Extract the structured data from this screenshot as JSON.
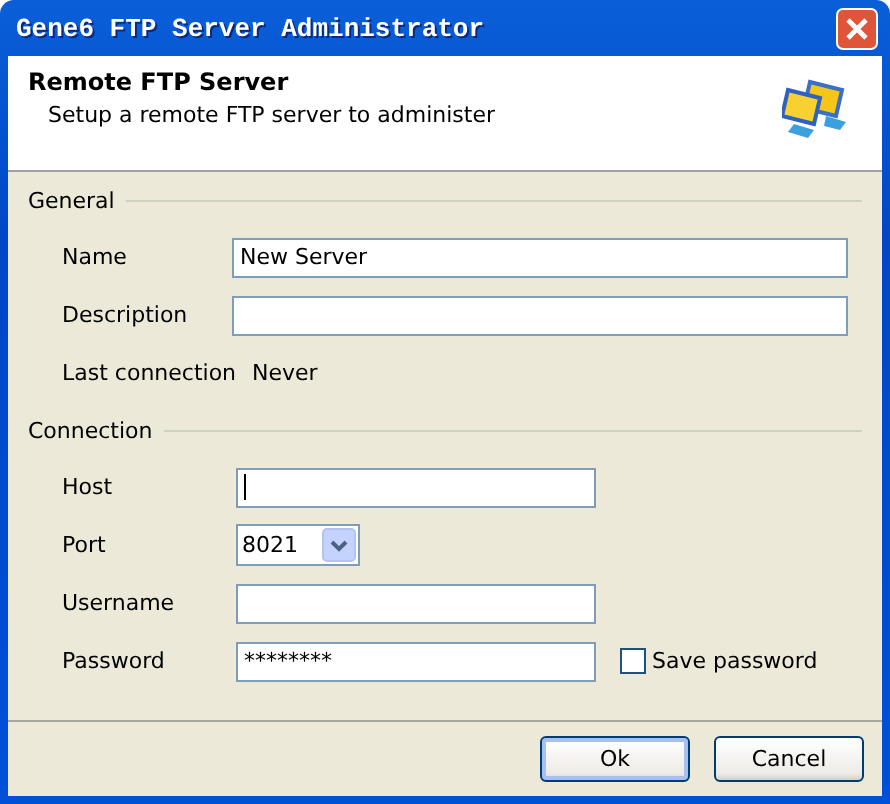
{
  "window": {
    "title": "Gene6 FTP Server Administrator"
  },
  "header": {
    "title": "Remote FTP Server",
    "subtitle": "Setup a remote FTP server to administer"
  },
  "sections": [
    {
      "title": "General",
      "rows": [
        {
          "kind": "text",
          "label": "Name",
          "value": "New Server",
          "focused": false
        },
        {
          "kind": "text",
          "label": "Description",
          "focused": false
        },
        {
          "kind": "static",
          "label": "Last connection",
          "value": "Never"
        }
      ]
    },
    {
      "title": "Connection",
      "rows": [
        {
          "kind": "short-text",
          "label": "Host",
          "focused": true
        },
        {
          "kind": "combo",
          "label": "Port",
          "value": "8021"
        },
        {
          "kind": "short-text",
          "label": "Username",
          "focused": false
        },
        {
          "kind": "password",
          "label": "Password",
          "value": "********",
          "option": {
            "label": "Save password",
            "checked": false
          }
        }
      ]
    }
  ],
  "buttons": [
    {
      "label": "Ok",
      "default": true
    },
    {
      "label": "Cancel",
      "default": false
    }
  ]
}
